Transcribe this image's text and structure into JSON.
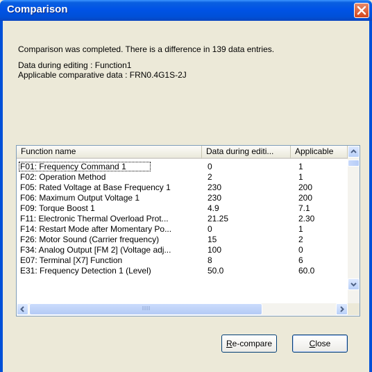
{
  "window": {
    "title": "Comparison"
  },
  "messages": {
    "result": "Comparison was completed. There is a difference in 139 data entries.",
    "editing": "Data during editing : Function1",
    "applicable": "Applicable comparative data : FRN0.4G1S-2J"
  },
  "table": {
    "columns": [
      "Function name",
      "Data during editi...",
      "Applicable"
    ],
    "rows": [
      [
        "F01: Frequency Command 1",
        "0",
        "1"
      ],
      [
        "F02: Operation Method",
        "2",
        "1"
      ],
      [
        "F05: Rated Voltage at Base Frequency 1",
        "230",
        "200"
      ],
      [
        "F06: Maximum Output Voltage 1",
        "230",
        "200"
      ],
      [
        "F09: Torque Boost 1",
        "4.9",
        "7.1"
      ],
      [
        "F11: Electronic Thermal Overload Prot...",
        "21.25",
        "2.30"
      ],
      [
        "F14: Restart Mode after Momentary Po...",
        "0",
        "1"
      ],
      [
        "F26: Motor Sound (Carrier frequency)",
        "15",
        "2"
      ],
      [
        "F34: Analog Output [FM 2] (Voltage adj...",
        "100",
        "0"
      ],
      [
        "E07: Terminal [X7] Function",
        "8",
        "6"
      ],
      [
        "E31: Frequency Detection 1 (Level)",
        "50.0",
        "60.0"
      ]
    ]
  },
  "buttons": {
    "recompare_key": "R",
    "recompare_rest": "e-compare",
    "close_key": "C",
    "close_rest": "lose"
  },
  "colors": {
    "titlebar": "#0050d8",
    "face": "#ece9d8",
    "close": "#d3461c"
  }
}
